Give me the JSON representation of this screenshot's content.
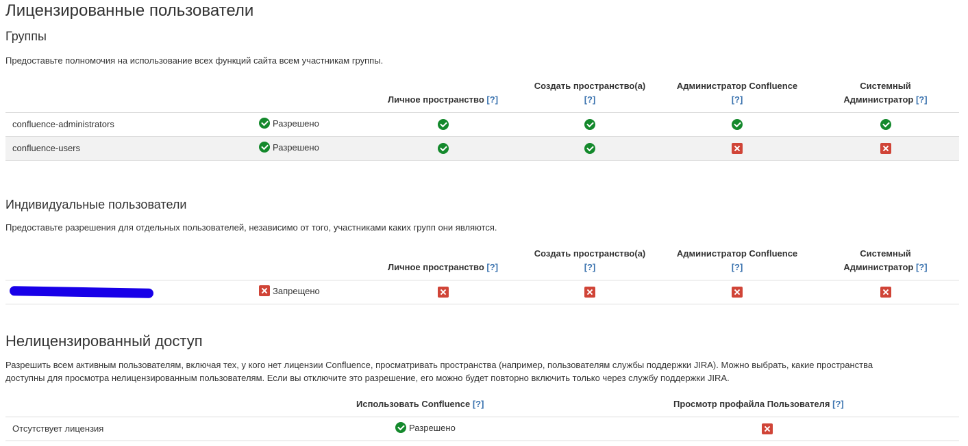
{
  "page_title": "Лицензированные пользователи",
  "groups": {
    "heading": "Группы",
    "description": "Предоставьте полномочия на использование всех функций сайта всем участникам группы.",
    "columns": {
      "personal_space": "Личное пространство",
      "create_space": "Создать пространство(а)",
      "confluence_admin": "Администратор Confluence",
      "system_admin_line1": "Системный",
      "system_admin_line2": "Администратор",
      "help": "[?]"
    },
    "rows": [
      {
        "name": "confluence-administrators",
        "status": "Разрешено"
      },
      {
        "name": "confluence-users",
        "status": "Разрешено"
      }
    ]
  },
  "individual": {
    "heading": "Индивидуальные пользователи",
    "description": "Предоставьте разрешения для отдельных пользователей, независимо от того, участниками каких групп они являются.",
    "columns": {
      "personal_space": "Личное пространство",
      "create_space": "Создать пространство(а)",
      "confluence_admin": "Администратор Confluence",
      "system_admin_line1": "Системный",
      "system_admin_line2": "Администратор",
      "help": "[?]"
    },
    "rows": [
      {
        "status": "Запрещено"
      }
    ]
  },
  "unlicensed": {
    "heading": "Нелицензированный доступ",
    "description_line1": "Разрешить всем активным пользователям, включая тех, у кого нет лицензии Confluence, просматривать пространства (например, пользователям службы поддержки JIRA). Можно выбрать, какие пространства",
    "description_line2": "доступны для просмотра нелицензированным пользователям. Если вы отключите это разрешение, его можно будет повторно включить только через службу поддержки JIRA.",
    "columns": {
      "use_confluence": "Использовать Confluence",
      "view_profile": "Просмотр профайла Пользователя",
      "help": "[?]"
    },
    "rows": [
      {
        "name": "Отсутствует лицензия",
        "status": "Разрешено"
      }
    ]
  },
  "colors": {
    "allowed": "#14892c",
    "denied": "#d04437",
    "link": "#3b73af"
  }
}
